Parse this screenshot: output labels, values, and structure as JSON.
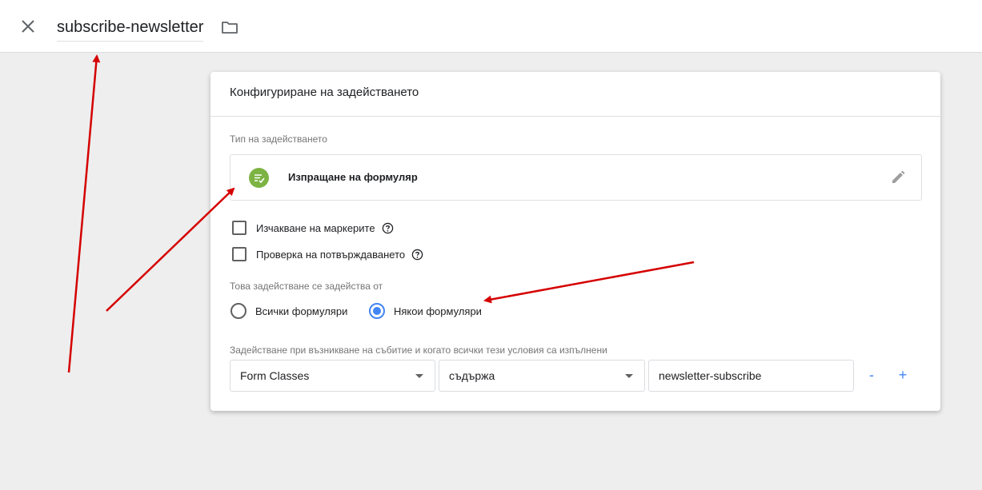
{
  "header": {
    "title": "subscribe-newsletter",
    "close_icon": "close-icon",
    "folder_icon": "folder-icon"
  },
  "card": {
    "title": "Конфигуриране на задействането",
    "trigger_type_label": "Тип на задействането",
    "trigger_type": {
      "name": "Изпращане на формуляр",
      "icon": "form-submit-icon",
      "icon_color": "#7cb342"
    },
    "checkboxes": [
      {
        "label": "Изчакване на маркерите",
        "checked": false
      },
      {
        "label": "Проверка на потвърждаването",
        "checked": false
      }
    ],
    "fires_on_label": "Това задействане се задейства от",
    "fires_on_options": [
      {
        "label": "Всички формуляри",
        "selected": false
      },
      {
        "label": "Някои формуляри",
        "selected": true
      }
    ],
    "condition_label": "Задействане при възникване на събитие и когато всички тези условия са изпълнени",
    "condition": {
      "variable": "Form Classes",
      "operator": "съдържа",
      "value": "newsletter-subscribe",
      "minus_label": "-",
      "plus_label": "+"
    }
  },
  "colors": {
    "accent": "#4285f4",
    "annotation_arrow": "#d50000",
    "background": "#eeeeee"
  }
}
